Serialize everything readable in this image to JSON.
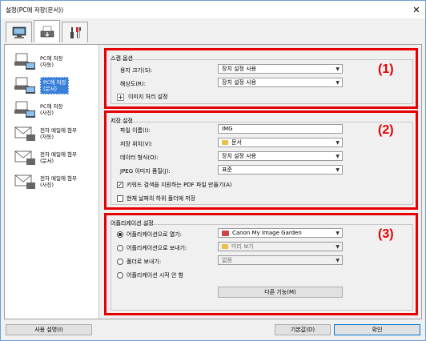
{
  "window": {
    "title": "설정(PC에 저장(문서))",
    "close_glyph": "✕"
  },
  "tabs": [
    {
      "name": "scan-from-computer",
      "icon": "computer-icon"
    },
    {
      "name": "scan-from-panel",
      "icon": "scanner-icon"
    },
    {
      "name": "general-settings",
      "icon": "tools-icon"
    }
  ],
  "sidebar": {
    "items": [
      {
        "line1": "PC에 저장",
        "line2": "(자동)"
      },
      {
        "line1": "PC에 저장",
        "line2": "(문서)"
      },
      {
        "line1": "PC에 저장",
        "line2": "(사진)"
      },
      {
        "line1": "전자 메일에 첨부",
        "line2": "(자동)"
      },
      {
        "line1": "전자 메일에 첨부",
        "line2": "(문서)"
      },
      {
        "line1": "전자 메일에 첨부",
        "line2": "(사진)"
      }
    ]
  },
  "scan_options": {
    "title": "스캔 옵션",
    "paper_size_label": "용지 크기(S):",
    "paper_size_value": "장치 설정 사용",
    "resolution_label": "해상도(R):",
    "resolution_value": "장치 설정 사용",
    "image_processing_label": "이미지 처리 설정",
    "marker": "(1)"
  },
  "save_settings": {
    "title": "저장 설정",
    "file_name_label": "파일 이름(I):",
    "file_name_value": "IMG",
    "save_in_label": "저장 위치(V):",
    "save_in_value": "문서",
    "data_format_label": "데이터 형식(O):",
    "data_format_value": "장치 설정 사용",
    "jpeg_quality_label": "JPEG 이미지 품질(J):",
    "jpeg_quality_value": "표준",
    "keyword_pdf_label": "키워드 검색을 지원하는 PDF 파일 만들기(A)",
    "keyword_pdf_checked": true,
    "subfolder_label": "현재 날짜의 하위 폴더에 저장",
    "subfolder_checked": false,
    "marker": "(2)"
  },
  "app_settings": {
    "title": "어플리케이션 설정",
    "open_app_label": "어플리케이션으로 열기:",
    "open_app_value": "Canon My Image Garden",
    "send_app_label": "어플리케이션으로 보내기:",
    "send_app_value": "미리 보기",
    "send_folder_label": "폴더로 보내기:",
    "send_folder_value": "없음",
    "no_app_label": "어플리케이션 시작 안 함",
    "more_functions_label": "다른 기능(M)",
    "selected_option": "open_app",
    "marker": "(3)"
  },
  "footer": {
    "instructions_label": "사용 설명(I)",
    "defaults_label": "기본값(D)",
    "ok_label": "확인"
  }
}
